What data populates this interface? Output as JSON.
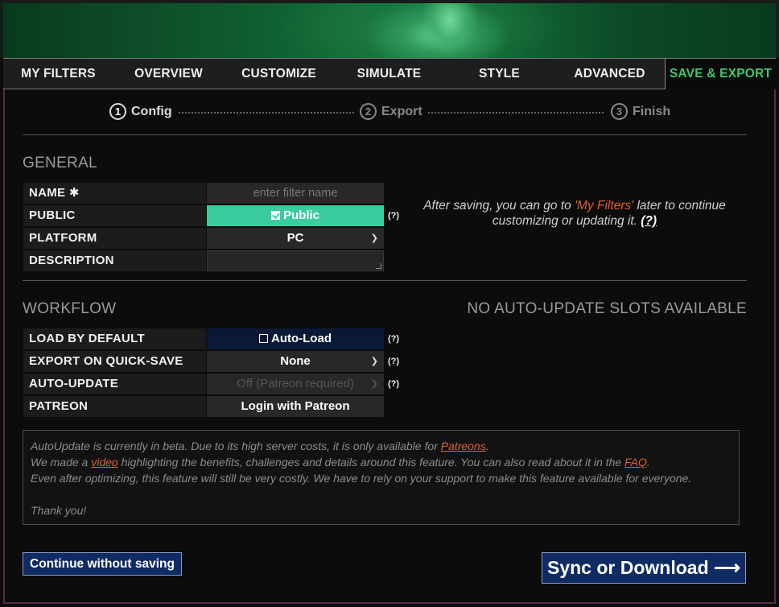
{
  "tabs": [
    {
      "label": "MY FILTERS"
    },
    {
      "label": "OVERVIEW"
    },
    {
      "label": "CUSTOMIZE"
    },
    {
      "label": "SIMULATE"
    },
    {
      "label": "STYLE"
    },
    {
      "label": "ADVANCED"
    },
    {
      "label": "SAVE & EXPORT",
      "active": true
    }
  ],
  "steps": [
    {
      "num": "1",
      "label": "Config",
      "active": true
    },
    {
      "num": "2",
      "label": "Export",
      "active": false
    },
    {
      "num": "3",
      "label": "Finish",
      "active": false
    }
  ],
  "general": {
    "title": "GENERAL",
    "name_label": "NAME ✱",
    "name_placeholder": "enter filter name",
    "public_label": "PUBLIC",
    "public_value": "Public",
    "public_checked": true,
    "platform_label": "PLATFORM",
    "platform_value": "PC",
    "description_label": "DESCRIPTION",
    "help": "(?)",
    "note_before": "After saving, you can go to ",
    "note_link": "'My Filters'",
    "note_after": " later to continue customizing or updating it. ",
    "note_help": "(?)"
  },
  "workflow": {
    "title": "WORKFLOW",
    "no_slots": "NO AUTO-UPDATE SLOTS AVAILABLE",
    "load_label": "LOAD BY DEFAULT",
    "load_value": "Auto-Load",
    "export_label": "EXPORT ON QUICK-SAVE",
    "export_value": "None",
    "autoupdate_label": "AUTO-UPDATE",
    "autoupdate_value": "Off (Patreon required)",
    "patreon_label": "PATREON",
    "patreon_value": "Login with Patreon",
    "help": "(?)"
  },
  "beta": {
    "line1_a": "AutoUpdate is currently in beta. Due to its high server costs, it is only available for ",
    "line1_link": "Patreons",
    "line1_b": ".",
    "line2_a": "We made a ",
    "line2_link1": "video",
    "line2_b": " highlighting the benefits, challenges and details around this feature. You can also read about it in the ",
    "line2_link2": "FAQ",
    "line2_c": ".",
    "line3": "Even after optimizing, this feature will still be very costly. We have to rely on your support to make this feature available for everyone.",
    "line4": "Thank you!"
  },
  "buttons": {
    "continue": "Continue without saving",
    "sync": "Sync or Download ⟶"
  },
  "colors": {
    "accent_green": "#3ec96d",
    "public_bg": "#3acca0",
    "button_bg": "#0f2b63",
    "link_orange": "#e0602e"
  }
}
